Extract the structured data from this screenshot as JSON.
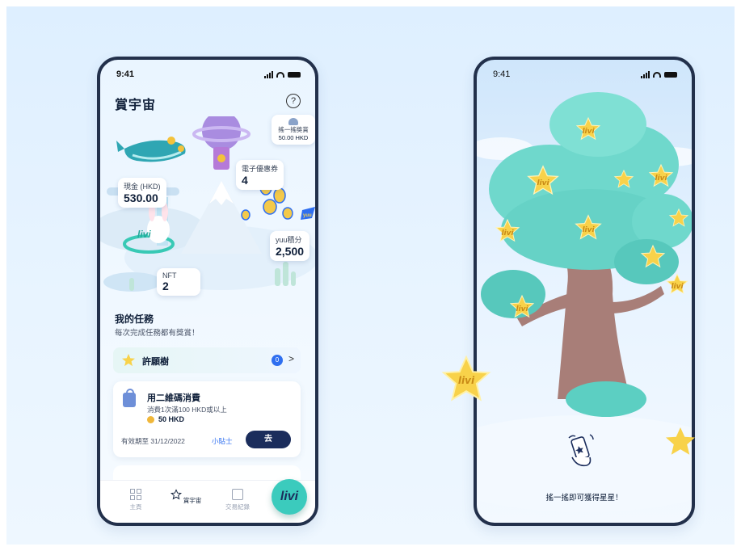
{
  "left_phone": {
    "status": {
      "time": "9:41"
    },
    "header": {
      "title": "賞宇宙",
      "help_icon": "question-icon"
    },
    "scene_cards": {
      "cash": {
        "label": "現金 (HKD)",
        "value": "530.00"
      },
      "coupons": {
        "label": "電子優惠券",
        "value": "4"
      },
      "shake": {
        "label": "搖一搖獎賞",
        "value": "50.00 HKD"
      },
      "yuu": {
        "label": "yuu積分",
        "value": "2,500"
      },
      "nft": {
        "label": "NFT",
        "value": "2"
      },
      "logo_tags": [
        "livi",
        "yuu"
      ]
    },
    "tasks": {
      "title": "我的任務",
      "subtitle": "每次完成任務都有獎賞！",
      "wish_tree": {
        "label": "許願樹",
        "badge": "0",
        "chevron": ">"
      },
      "task_card": {
        "name": "用二維碼消費",
        "desc": "消費1次滿100 HKD或以上",
        "reward": "50 HKD",
        "expiry": "有效期至 31/12/2022",
        "tip": "小貼士",
        "go": "去"
      }
    },
    "tabbar": {
      "home": "主頁",
      "universe": "賞宇宙",
      "transactions": "交易紀錄",
      "fab": "livi"
    }
  },
  "right_phone": {
    "status": {
      "time": "9:41"
    },
    "star_label": "livi",
    "shake_hint": "搖一搖即可獲得星星！"
  },
  "colors": {
    "navy": "#1b2d5c",
    "teal": "#3bcbbd",
    "accent_blue": "#2f6ff0",
    "star_yellow": "#f8d24a",
    "trunk": "#a87e78"
  }
}
